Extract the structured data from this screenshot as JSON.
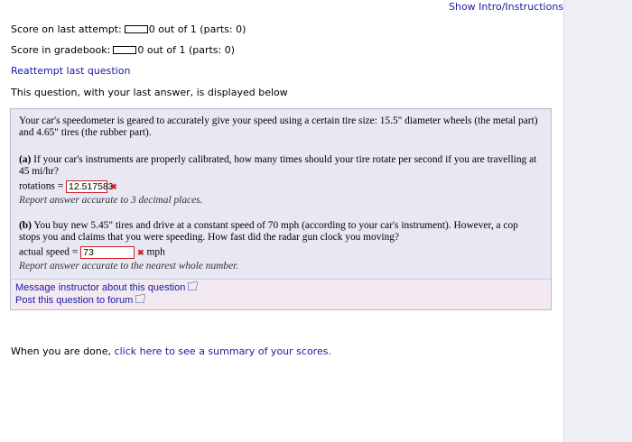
{
  "header": {
    "intro_link": "Show Intro/Instructions"
  },
  "scores": {
    "last_attempt_label": "Score on last attempt:",
    "last_attempt_value": "0 out of 1 (parts: 0)",
    "gradebook_label": "Score in gradebook:",
    "gradebook_value": "0 out of 1 (parts: 0)"
  },
  "reattempt_link": "Reattempt last question",
  "display_note": "This question, with your last answer, is displayed below",
  "question": {
    "intro": "Your car's speedometer is geared to accurately give your speed using a certain tire size: 15.5\" diameter wheels (the metal part) and 4.65\" tires (the rubber part).",
    "part_a": {
      "label": "(a)",
      "text": " If your car's instruments are properly calibrated, how many times should your tire rotate per second if you are travelling at 45 mi/hr?",
      "answer_label": "rotations =",
      "answer_value": "12.517583",
      "mark": "✖",
      "note": "Report answer accurate to 3 decimal places."
    },
    "part_b": {
      "label": "(b)",
      "text": " You buy new 5.45\" tires and drive at a constant speed of 70 mph (according to your car's instrument). However, a cop stops you and claims that you were speeding. How fast did the radar gun clock you moving?",
      "answer_label": "actual speed =",
      "answer_value": "73",
      "mark": "✖",
      "unit": "mph",
      "note": "Report answer accurate to the nearest whole number."
    }
  },
  "links": {
    "message_instructor": "Message instructor about this question",
    "post_forum": "Post this question to forum"
  },
  "footer": {
    "prefix": "When you are done, ",
    "link": "click here to see a summary of your scores."
  },
  "colors": {
    "link": "#1a1aa6",
    "box_bg": "#e8e8f4",
    "msg_bg": "#f3e9f0",
    "error": "#cc2222"
  }
}
